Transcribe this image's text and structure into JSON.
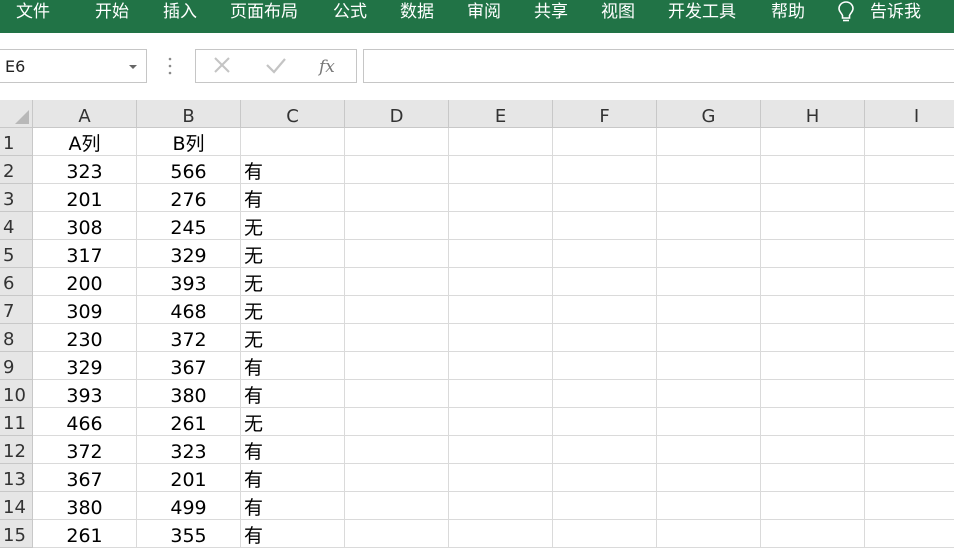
{
  "ribbon": {
    "tabs": [
      "文件",
      "开始",
      "插入",
      "页面布局",
      "公式",
      "数据",
      "审阅",
      "共享",
      "视图",
      "开发工具",
      "帮助"
    ],
    "tell_me": "告诉我"
  },
  "formula_bar": {
    "name_box": "E6",
    "formula": ""
  },
  "sheet": {
    "columns": [
      "A",
      "B",
      "C",
      "D",
      "E",
      "F",
      "G",
      "H",
      "I"
    ],
    "rows": [
      {
        "num": "1",
        "A": "A列",
        "B": "B列",
        "C": ""
      },
      {
        "num": "2",
        "A": "323",
        "B": "566",
        "C": "有"
      },
      {
        "num": "3",
        "A": "201",
        "B": "276",
        "C": "有"
      },
      {
        "num": "4",
        "A": "308",
        "B": "245",
        "C": "无"
      },
      {
        "num": "5",
        "A": "317",
        "B": "329",
        "C": "无"
      },
      {
        "num": "6",
        "A": "200",
        "B": "393",
        "C": "无"
      },
      {
        "num": "7",
        "A": "309",
        "B": "468",
        "C": "无"
      },
      {
        "num": "8",
        "A": "230",
        "B": "372",
        "C": "无"
      },
      {
        "num": "9",
        "A": "329",
        "B": "367",
        "C": "有"
      },
      {
        "num": "10",
        "A": "393",
        "B": "380",
        "C": "有"
      },
      {
        "num": "11",
        "A": "466",
        "B": "261",
        "C": "无"
      },
      {
        "num": "12",
        "A": "372",
        "B": "323",
        "C": "有"
      },
      {
        "num": "13",
        "A": "367",
        "B": "201",
        "C": "有"
      },
      {
        "num": "14",
        "A": "380",
        "B": "499",
        "C": "有"
      },
      {
        "num": "15",
        "A": "261",
        "B": "355",
        "C": "有"
      }
    ]
  }
}
